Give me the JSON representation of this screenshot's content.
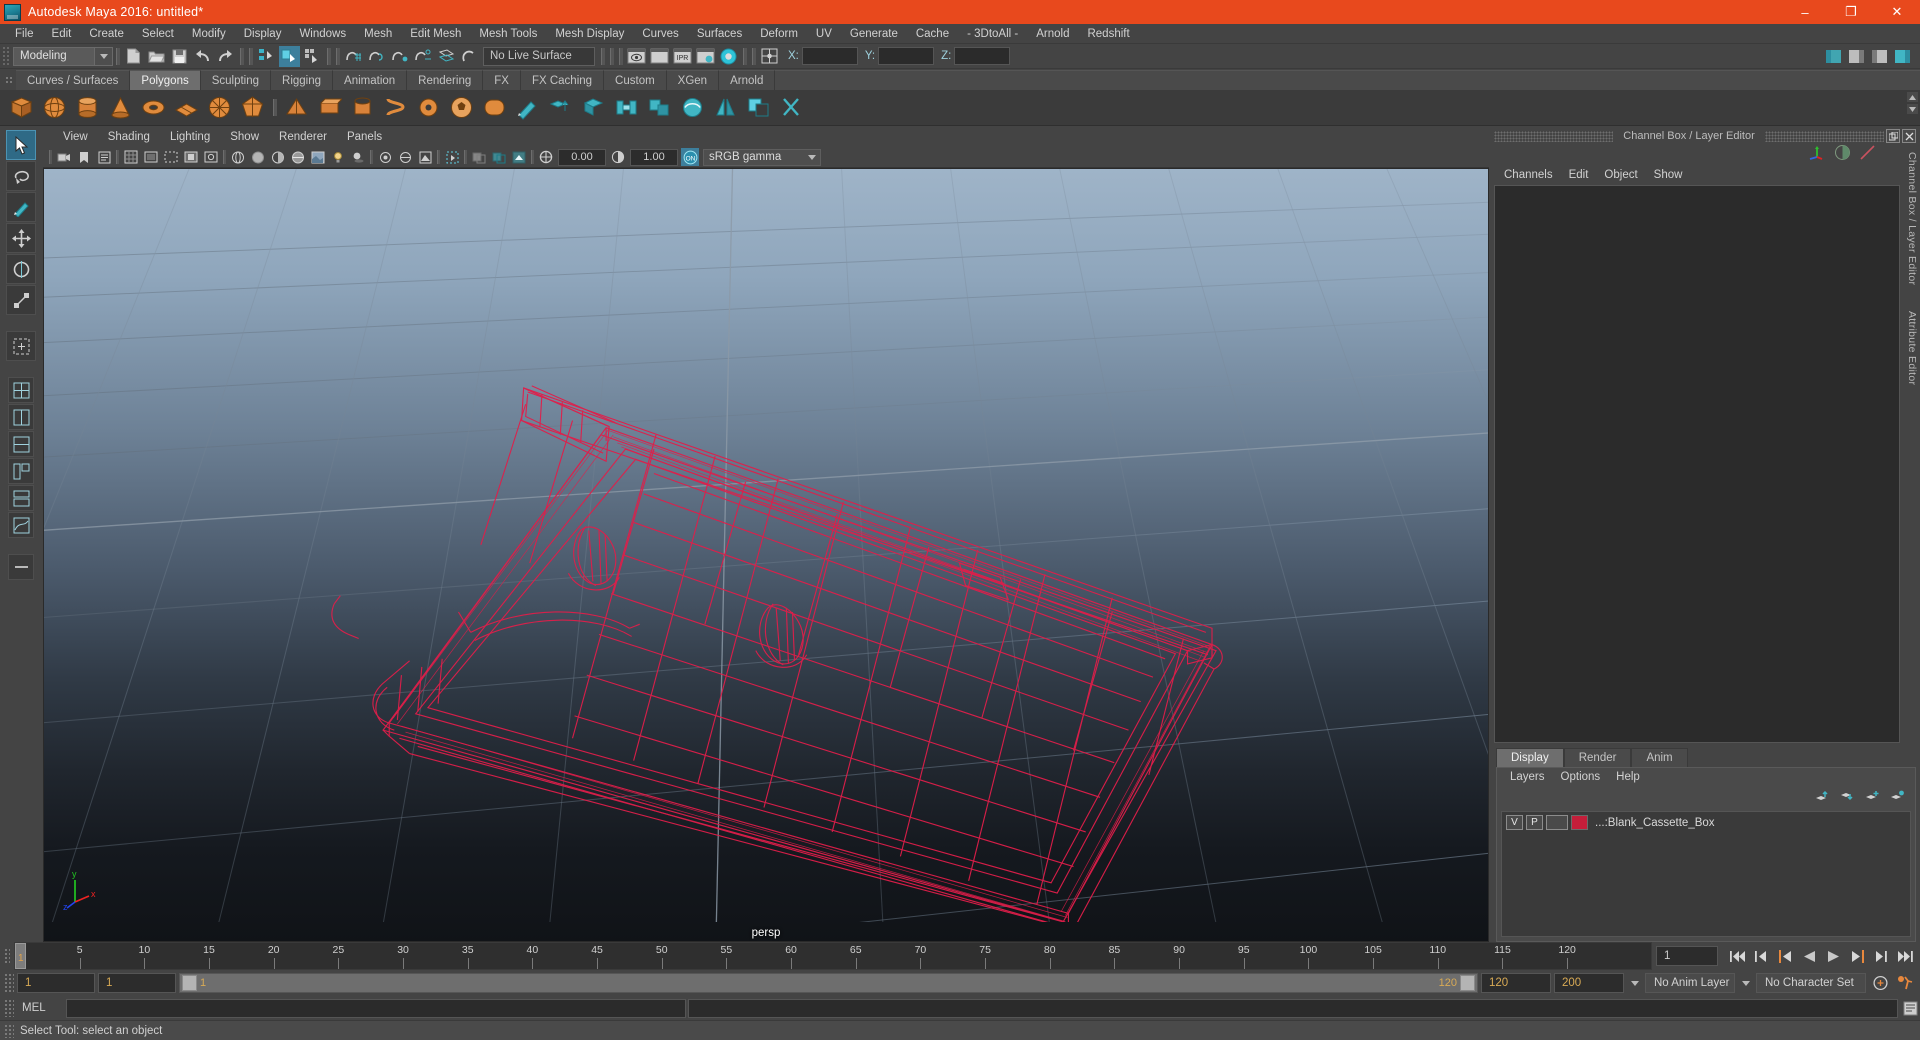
{
  "window": {
    "title": "Autodesk Maya 2016: untitled*",
    "icon": "maya-logo-icon",
    "minimize": "–",
    "maximize": "❐",
    "close": "✕"
  },
  "menubar": {
    "items": [
      "File",
      "Edit",
      "Create",
      "Select",
      "Modify",
      "Display",
      "Windows",
      "Mesh",
      "Edit Mesh",
      "Mesh Tools",
      "Mesh Display",
      "Curves",
      "Surfaces",
      "Deform",
      "UV",
      "Generate",
      "Cache",
      "- 3DtoAll -",
      "Arnold",
      "Redshift"
    ]
  },
  "statusline": {
    "menuset": "Modeling",
    "live_surface": "No Live Surface",
    "coord_x_label": "X:",
    "coord_y_label": "Y:",
    "coord_z_label": "Z:",
    "coord_x_value": "",
    "coord_y_value": "",
    "coord_z_value": ""
  },
  "shelf": {
    "tabs": [
      {
        "label": "Curves / Surfaces",
        "active": false
      },
      {
        "label": "Polygons",
        "active": true
      },
      {
        "label": "Sculpting",
        "active": false
      },
      {
        "label": "Rigging",
        "active": false
      },
      {
        "label": "Animation",
        "active": false
      },
      {
        "label": "Rendering",
        "active": false
      },
      {
        "label": "FX",
        "active": false
      },
      {
        "label": "FX Caching",
        "active": false
      },
      {
        "label": "Custom",
        "active": false
      },
      {
        "label": "XGen",
        "active": false
      },
      {
        "label": "Arnold",
        "active": false
      }
    ]
  },
  "viewport_panel": {
    "menu": [
      "View",
      "Shading",
      "Lighting",
      "Show",
      "Renderer",
      "Panels"
    ],
    "exposure": "0.00",
    "gamma": "1.00",
    "color_profile": "sRGB gamma",
    "camera_label": "persp",
    "axis": {
      "x": "x",
      "y": "y",
      "z": "z"
    }
  },
  "channel_box": {
    "panel_title": "Channel Box / Layer Editor",
    "menu": [
      "Channels",
      "Edit",
      "Object",
      "Show"
    ],
    "vertical_tabs": [
      "Channel Box / Layer Editor",
      "Attribute Editor"
    ]
  },
  "layer_editor": {
    "tabs": [
      {
        "label": "Display",
        "active": true
      },
      {
        "label": "Render",
        "active": false
      },
      {
        "label": "Anim",
        "active": false
      }
    ],
    "menu": [
      "Layers",
      "Options",
      "Help"
    ],
    "layers": [
      {
        "visibility": "V",
        "playback": "P",
        "type": "",
        "color": "#c41e3a",
        "name": "...:Blank_Cassette_Box"
      }
    ]
  },
  "timeline": {
    "ticks": [
      5,
      10,
      15,
      20,
      25,
      30,
      35,
      40,
      45,
      50,
      55,
      60,
      65,
      70,
      75,
      80,
      85,
      90,
      95,
      100,
      105,
      110,
      115,
      120
    ],
    "current_frame": "1",
    "current_frame_field": "1",
    "playback_buttons": [
      "go-to-start-icon",
      "step-back-keyframe-icon",
      "step-back-frame-icon",
      "play-backwards-icon",
      "play-forwards-icon",
      "step-forward-frame-icon",
      "step-forward-keyframe-icon",
      "go-to-end-icon"
    ]
  },
  "range_slider": {
    "anim_start": "1",
    "range_start": "1",
    "slider_start_label": "1",
    "slider_end_label": "120",
    "range_end": "120",
    "anim_end": "200",
    "anim_layer": "No Anim Layer",
    "character_set": "No Character Set"
  },
  "command_line": {
    "language": "MEL",
    "input_value": "",
    "output_value": ""
  },
  "help_line": {
    "text": "Select Tool: select an object"
  },
  "colors": {
    "title_bar": "#e8491d",
    "accent_teal": "#41b6c4",
    "mesh_wireframe": "#e01e4a",
    "panel_bg": "#444444",
    "field_bg": "#2b2b2b",
    "active_tab": "#6e6e6e"
  }
}
